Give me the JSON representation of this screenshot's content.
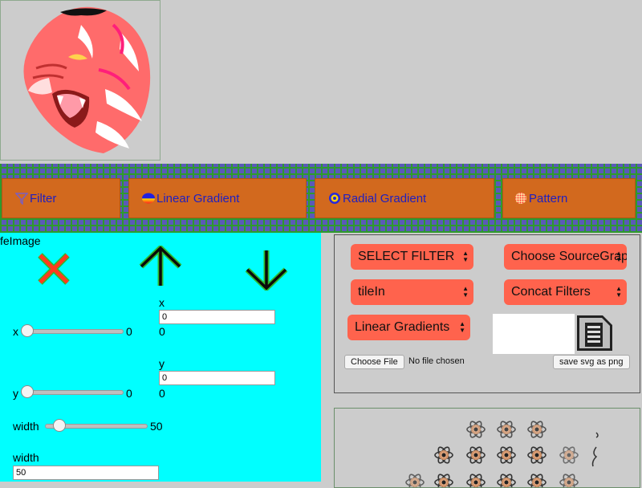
{
  "toolbar": {
    "filter_label": "Filter",
    "linear_gradient_label": "Linear Gradient",
    "radial_gradient_label": "Radial Gradient",
    "pattern_label": "Pattern"
  },
  "left_panel": {
    "title": "feImage",
    "x_slider": {
      "label": "x",
      "value": "0",
      "readout": "0"
    },
    "x_field": {
      "label": "x",
      "value": "0"
    },
    "y_slider": {
      "label": "y",
      "value": "0",
      "readout": "0"
    },
    "y_field": {
      "label": "y",
      "value": "0"
    },
    "width_slider": {
      "label": "width",
      "value": "50"
    },
    "width_field": {
      "label": "width",
      "value": "50"
    }
  },
  "controls": {
    "select_filter": "SELECT FILTER",
    "choose_source": "Choose SourceGraphic",
    "tile_in": "tileIn",
    "concat_filters": "Concat Filters",
    "linear_gradients": "Linear Gradients",
    "choose_file_label": "Choose File",
    "file_status": "No file chosen",
    "save_png_label": "save svg as png"
  },
  "colors": {
    "toolbar_button": "#d2691e",
    "select_bg": "#ff634d",
    "left_panel_bg": "#00ffff"
  }
}
